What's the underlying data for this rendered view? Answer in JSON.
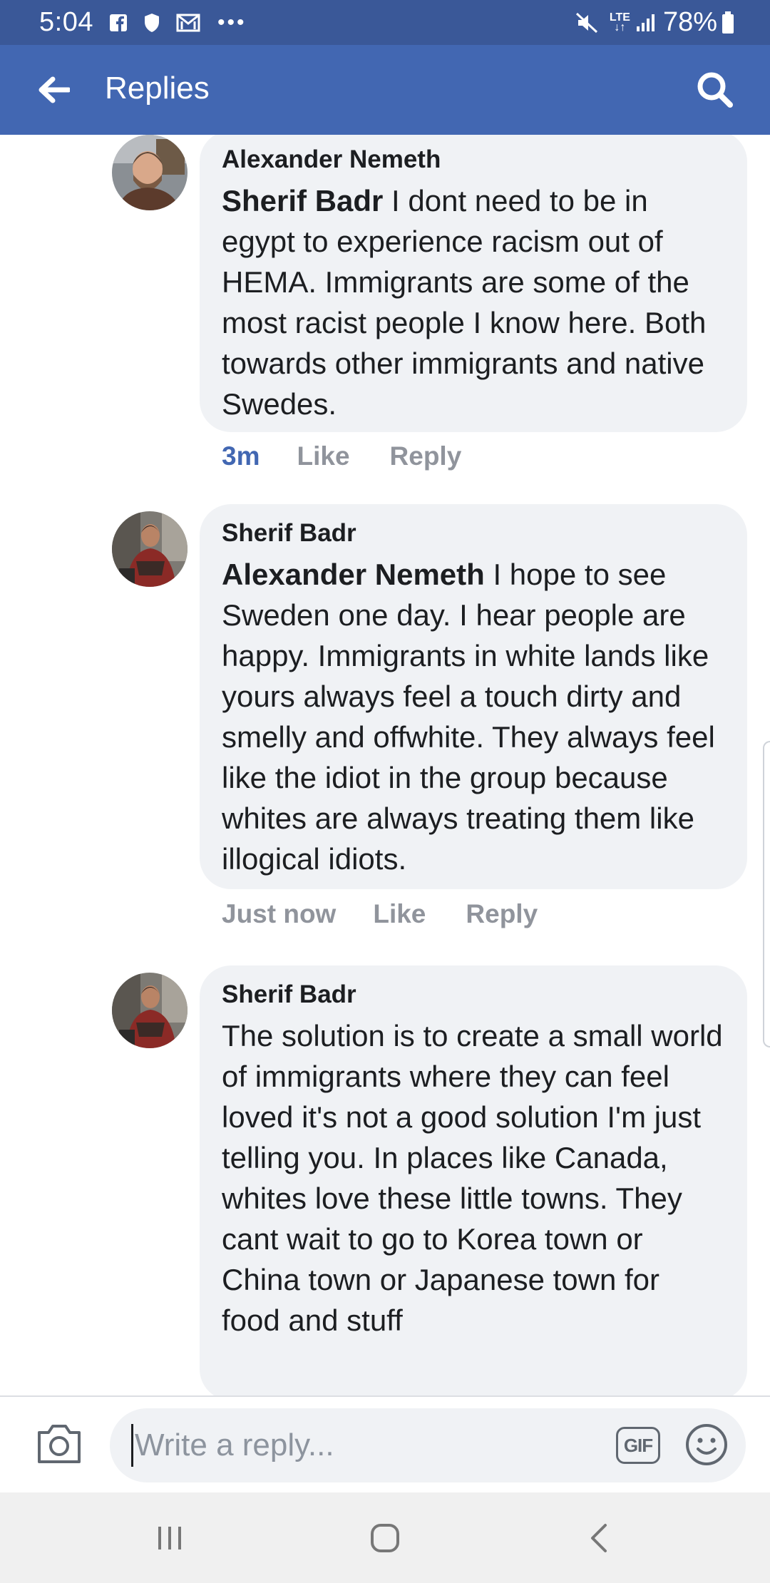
{
  "status_bar": {
    "time": "5:04",
    "network": "LTE",
    "battery_percent": "78%",
    "icons": [
      "facebook-icon",
      "shield-icon",
      "gmail-icon",
      "more-dots-icon",
      "mute-icon",
      "signal-icon",
      "battery-icon"
    ]
  },
  "app_bar": {
    "title": "Replies",
    "back_icon": "arrow-left-icon",
    "search_icon": "search-icon"
  },
  "comments": [
    {
      "author": "Alexander Nemeth",
      "mention": "Sherif Badr",
      "text": " I dont need to be in egypt to experience racism out of HEMA. Immigrants are some of the most racist people I know here. Both towards other immigrants and native Swedes.",
      "time": "3m",
      "like_label": "Like",
      "reply_label": "Reply"
    },
    {
      "author": "Sherif Badr",
      "mention": "Alexander Nemeth",
      "text": " I hope to see Sweden one day. I hear people are happy. Immigrants in white lands like yours always feel a touch dirty and smelly and offwhite. They always feel like the idiot in the group because whites are always treating them like illogical idiots.",
      "time": "Just now",
      "like_label": "Like",
      "reply_label": "Reply"
    },
    {
      "author": "Sherif Badr",
      "mention": "",
      "text": "The solution is to create a small world of immigrants where they can feel loved  it's not a good solution I'm just telling you. In places like Canada, whites love these little towns. They cant wait to go to Korea town or China town or Japanese town for food and stuff"
    }
  ],
  "composer": {
    "placeholder": "Write a reply...",
    "gif_label": "GIF",
    "camera_icon": "camera-icon",
    "emoji_icon": "smiley-icon"
  },
  "colors": {
    "status_bar": "#3a5898",
    "app_bar": "#4267b2",
    "bubble": "#f0f2f5",
    "meta_text": "#90949c",
    "recent_time": "#4267b2"
  }
}
